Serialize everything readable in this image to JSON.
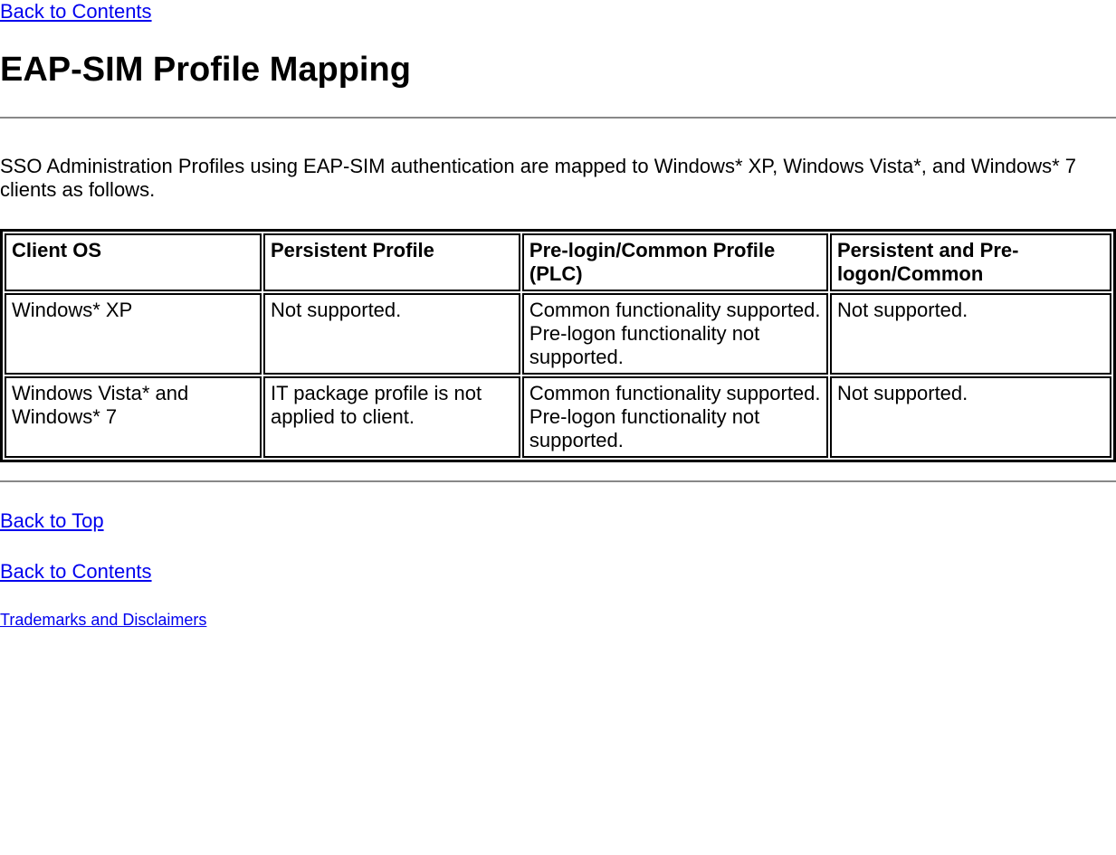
{
  "links": {
    "back_to_contents": "Back to Contents",
    "back_to_top": "Back to Top",
    "trademarks": "Trademarks and Disclaimers"
  },
  "heading": "EAP-SIM Profile Mapping",
  "intro": "SSO Administration Profiles using EAP-SIM authentication are mapped to Windows* XP, Windows Vista*, and Windows* 7 clients as follows.",
  "table": {
    "headers": {
      "col1": "Client OS",
      "col2": "Persistent Profile",
      "col3": "Pre-login/Common Profile (PLC)",
      "col4": "Persistent and Pre-logon/Common"
    },
    "rows": [
      {
        "col1": "Windows* XP",
        "col2": "Not supported.",
        "col3_line1": "Common functionality supported.",
        "col3_line2": "Pre-logon functionality not supported.",
        "col4": "Not supported."
      },
      {
        "col1": "Windows Vista* and Windows* 7",
        "col2": "IT package profile is not applied to client.",
        "col3_line1": "Common functionality supported.",
        "col3_line2": "Pre-logon functionality not supported.",
        "col4": "Not supported."
      }
    ]
  }
}
